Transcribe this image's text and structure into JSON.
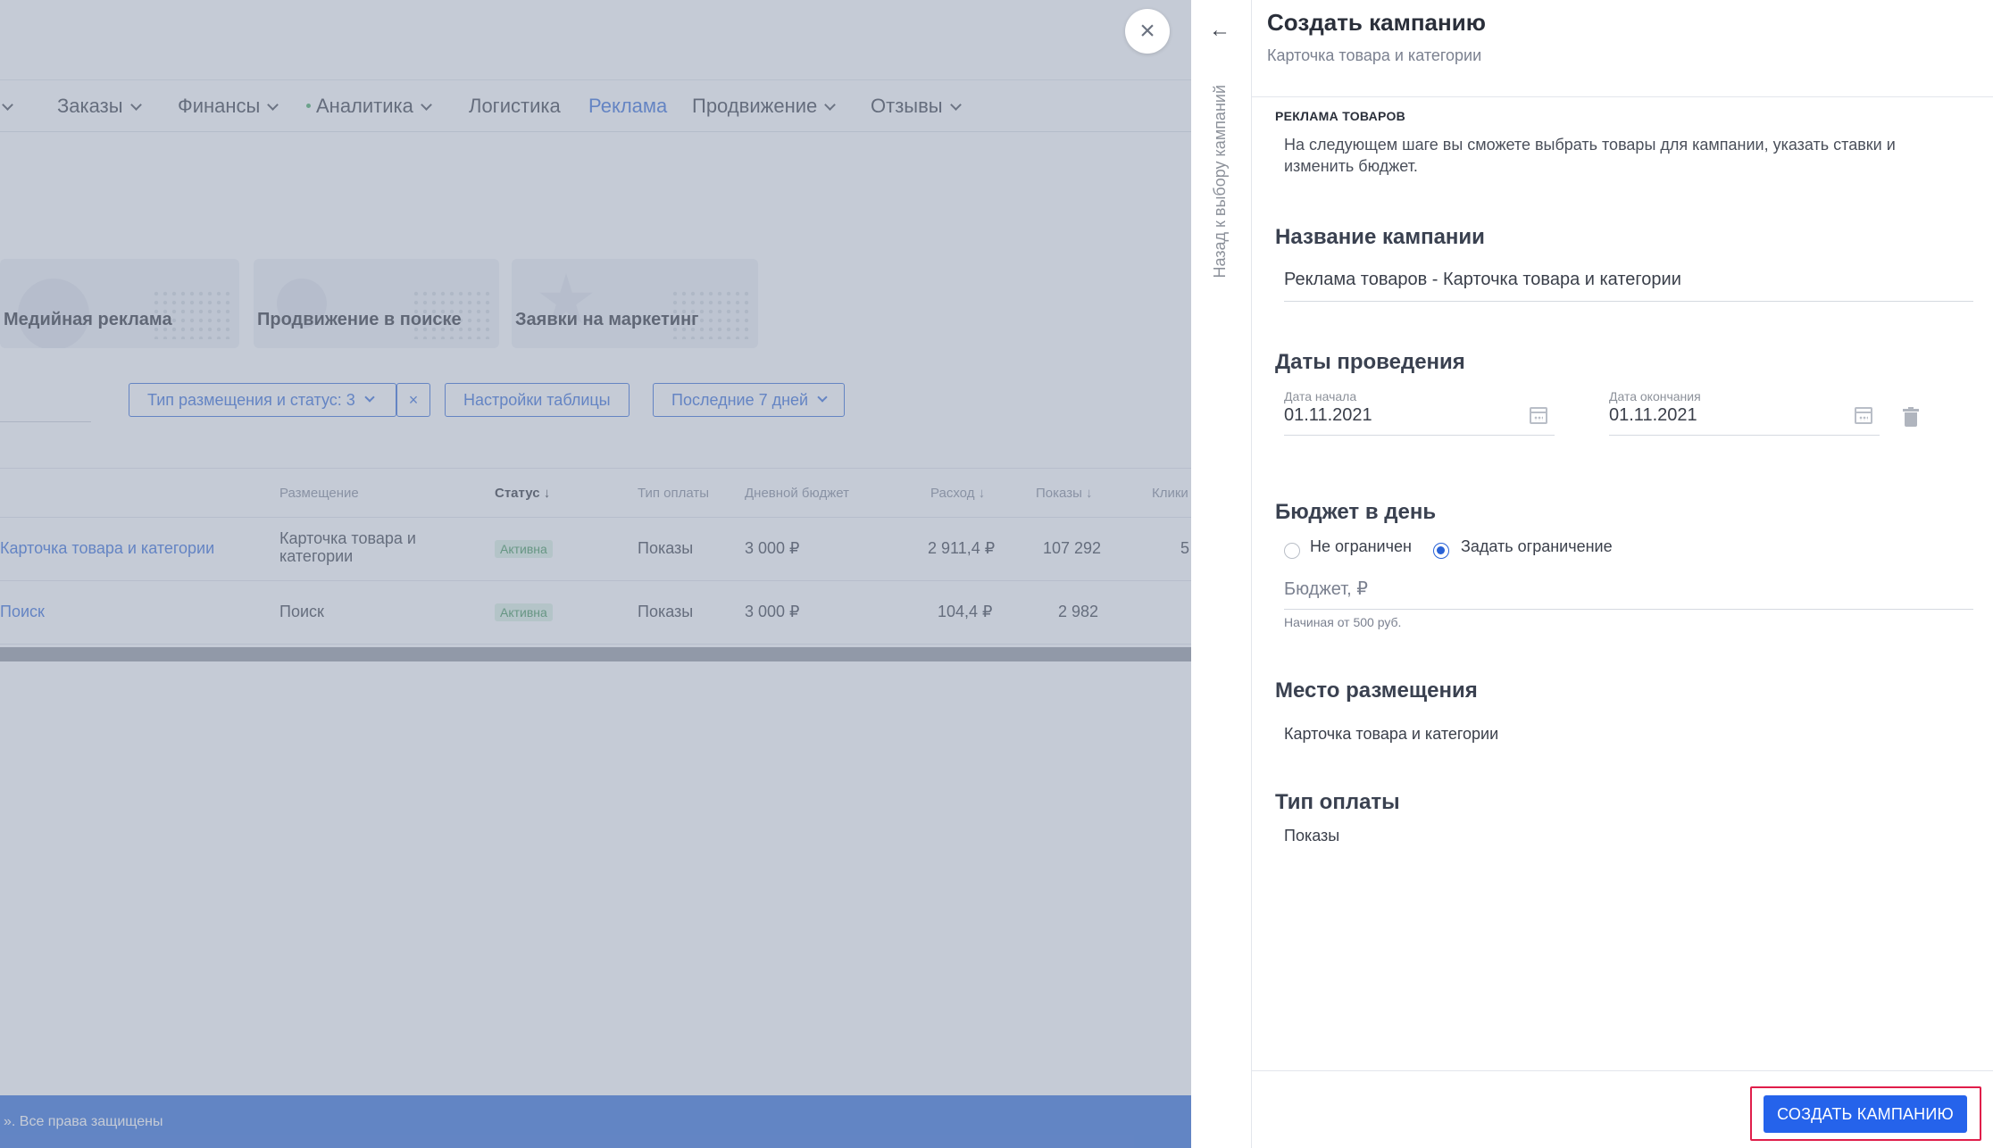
{
  "nav": {
    "items": [
      {
        "label": "Заказы"
      },
      {
        "label": "Финансы"
      },
      {
        "label": "Аналитика"
      },
      {
        "label": "Логистика"
      },
      {
        "label": "Реклама"
      },
      {
        "label": "Продвижение"
      },
      {
        "label": "Отзывы"
      }
    ]
  },
  "cards": [
    {
      "label": "Медийная реклама",
      "icon": "media-icon"
    },
    {
      "label": "Продвижение в поиске",
      "icon": "search-promo-icon"
    },
    {
      "label": "Заявки на маркетинг",
      "icon": "star-icon"
    }
  ],
  "filters": {
    "placement_status": "Тип размещения и статус: 3",
    "clear": "×",
    "table_settings": "Настройки таблицы",
    "period": "Последние 7 дней"
  },
  "table": {
    "headers": [
      "Размещение",
      "Статус",
      "Тип оплаты",
      "Дневной бюджет",
      "Расход",
      "Показы",
      "Клики"
    ],
    "rows": [
      {
        "name": "Карточка товара и категории",
        "placement": "Карточка товара и категории",
        "status": "Активна",
        "payment": "Показы",
        "daily_budget": "3 000 ₽",
        "spend": "2 911,4 ₽",
        "impressions": "107 292",
        "clicks": "5"
      },
      {
        "name": "Поиск",
        "placement": "Поиск",
        "status": "Активна",
        "payment": "Показы",
        "daily_budget": "3 000 ₽",
        "spend": "104,4 ₽",
        "impressions": "2 982",
        "clicks": ""
      }
    ]
  },
  "footer": {
    "text": "». Все права защищены"
  },
  "panel": {
    "back_label": "Назад к выбору кампаний",
    "title": "Создать кампанию",
    "subtitle": "Карточка товара и категории",
    "kicker": "РЕКЛАМА ТОВАРОВ",
    "description": "На следующем шаге вы сможете выбрать товары для кампании, указать ставки и изменить бюджет.",
    "name_section": {
      "heading": "Название кампании",
      "value": "Реклама товаров - Карточка товара и категории"
    },
    "dates_section": {
      "heading": "Даты проведения",
      "start_label": "Дата начала",
      "start_value": "01.11.2021",
      "end_label": "Дата окончания",
      "end_value": "01.11.2021"
    },
    "budget_section": {
      "heading": "Бюджет в день",
      "option_unlimited": "Не ограничен",
      "option_limit": "Задать ограничение",
      "selected": "limit",
      "placeholder": "Бюджет, ₽",
      "hint": "Начиная от 500 руб."
    },
    "placement_section": {
      "heading": "Место размещения",
      "value": "Карточка товара и категории"
    },
    "payment_section": {
      "heading": "Тип оплаты",
      "value": "Показы"
    },
    "create_button": "СОЗДАТЬ КАМПАНИЮ"
  },
  "colors": {
    "accent": "#2563eb",
    "highlight": "#e01e4a",
    "footer": "#2565d8"
  }
}
